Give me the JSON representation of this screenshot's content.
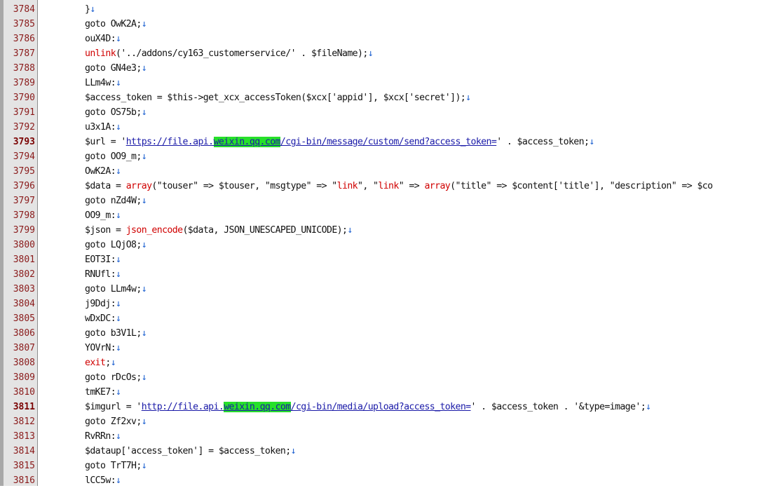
{
  "editor": {
    "colors": {
      "keyword": "#d00000",
      "url": "#1a1aa8",
      "highlight": "#27e02a",
      "newline_marker": "#1b5fd0",
      "line_number": "#8a1a1a"
    },
    "lines": [
      {
        "num": "3784",
        "segments": [
          {
            "t": "}"
          },
          {
            "t": "↓",
            "c": "arrow"
          }
        ]
      },
      {
        "num": "3785",
        "segments": [
          {
            "t": "goto OwK2A;"
          },
          {
            "t": "↓",
            "c": "arrow"
          }
        ]
      },
      {
        "num": "3786",
        "segments": [
          {
            "t": "ouX4D:"
          },
          {
            "t": "↓",
            "c": "arrow"
          }
        ]
      },
      {
        "num": "3787",
        "segments": [
          {
            "t": "unlink",
            "c": "keyword"
          },
          {
            "t": "('../addons/cy163_customerservice/' . $fileName);"
          },
          {
            "t": "↓",
            "c": "arrow"
          }
        ]
      },
      {
        "num": "3788",
        "segments": [
          {
            "t": "goto GN4e3;"
          },
          {
            "t": "↓",
            "c": "arrow"
          }
        ]
      },
      {
        "num": "3789",
        "segments": [
          {
            "t": "LLm4w:"
          },
          {
            "t": "↓",
            "c": "arrow"
          }
        ]
      },
      {
        "num": "3790",
        "segments": [
          {
            "t": "$access_token = $this->get_xcx_accessToken($xcx['appid'], $xcx['secret']);"
          },
          {
            "t": "↓",
            "c": "arrow"
          }
        ]
      },
      {
        "num": "3791",
        "segments": [
          {
            "t": "goto OS75b;"
          },
          {
            "t": "↓",
            "c": "arrow"
          }
        ]
      },
      {
        "num": "3792",
        "segments": [
          {
            "t": "u3x1A:"
          },
          {
            "t": "↓",
            "c": "arrow"
          }
        ]
      },
      {
        "num": "3793",
        "bold": true,
        "segments": [
          {
            "t": "$url = '"
          },
          {
            "t": "https://file.api.",
            "c": "url"
          },
          {
            "t": "weixin.qq.com",
            "c": "highlight"
          },
          {
            "t": "/cgi-bin/message/custom/send?access_token=",
            "c": "url"
          },
          {
            "t": "' . $access_token;"
          },
          {
            "t": "↓",
            "c": "arrow"
          }
        ]
      },
      {
        "num": "3794",
        "segments": [
          {
            "t": "goto OO9_m;"
          },
          {
            "t": "↓",
            "c": "arrow"
          }
        ]
      },
      {
        "num": "3795",
        "segments": [
          {
            "t": "OwK2A:"
          },
          {
            "t": "↓",
            "c": "arrow"
          }
        ]
      },
      {
        "num": "3796",
        "segments": [
          {
            "t": "$data = "
          },
          {
            "t": "array",
            "c": "keyword"
          },
          {
            "t": "(\"touser\" => $touser, \"msgtype\" => \""
          },
          {
            "t": "link",
            "c": "keyword"
          },
          {
            "t": "\", \""
          },
          {
            "t": "link",
            "c": "keyword"
          },
          {
            "t": "\" => "
          },
          {
            "t": "array",
            "c": "keyword"
          },
          {
            "t": "(\"title\" => $content['title'], \"description\" => $co"
          }
        ]
      },
      {
        "num": "3797",
        "segments": [
          {
            "t": "goto nZd4W;"
          },
          {
            "t": "↓",
            "c": "arrow"
          }
        ]
      },
      {
        "num": "3798",
        "segments": [
          {
            "t": "OO9_m:"
          },
          {
            "t": "↓",
            "c": "arrow"
          }
        ]
      },
      {
        "num": "3799",
        "segments": [
          {
            "t": "$json = "
          },
          {
            "t": "json_encode",
            "c": "keyword"
          },
          {
            "t": "($data, JSON_UNESCAPED_UNICODE);"
          },
          {
            "t": "↓",
            "c": "arrow"
          }
        ]
      },
      {
        "num": "3800",
        "segments": [
          {
            "t": "goto LQjO8;"
          },
          {
            "t": "↓",
            "c": "arrow"
          }
        ]
      },
      {
        "num": "3801",
        "segments": [
          {
            "t": "EOT3I:"
          },
          {
            "t": "↓",
            "c": "arrow"
          }
        ]
      },
      {
        "num": "3802",
        "segments": [
          {
            "t": "RNUfl:"
          },
          {
            "t": "↓",
            "c": "arrow"
          }
        ]
      },
      {
        "num": "3803",
        "segments": [
          {
            "t": "goto LLm4w;"
          },
          {
            "t": "↓",
            "c": "arrow"
          }
        ]
      },
      {
        "num": "3804",
        "segments": [
          {
            "t": "j9Ddj:"
          },
          {
            "t": "↓",
            "c": "arrow"
          }
        ]
      },
      {
        "num": "3805",
        "segments": [
          {
            "t": "wDxDC:"
          },
          {
            "t": "↓",
            "c": "arrow"
          }
        ]
      },
      {
        "num": "3806",
        "segments": [
          {
            "t": "goto b3V1L;"
          },
          {
            "t": "↓",
            "c": "arrow"
          }
        ]
      },
      {
        "num": "3807",
        "segments": [
          {
            "t": "YOVrN:"
          },
          {
            "t": "↓",
            "c": "arrow"
          }
        ]
      },
      {
        "num": "3808",
        "segments": [
          {
            "t": "exit",
            "c": "keyword"
          },
          {
            "t": ";"
          },
          {
            "t": "↓",
            "c": "arrow"
          }
        ]
      },
      {
        "num": "3809",
        "segments": [
          {
            "t": "goto rDcOs;"
          },
          {
            "t": "↓",
            "c": "arrow"
          }
        ]
      },
      {
        "num": "3810",
        "segments": [
          {
            "t": "tmKE7:"
          },
          {
            "t": "↓",
            "c": "arrow"
          }
        ]
      },
      {
        "num": "3811",
        "bold": true,
        "segments": [
          {
            "t": "$imgurl = '"
          },
          {
            "t": "http://file.api.",
            "c": "url"
          },
          {
            "t": "weixin.qq.com",
            "c": "highlight"
          },
          {
            "t": "/cgi-bin/media/upload?access_token=",
            "c": "url"
          },
          {
            "t": "' . $access_token . '&type=image';"
          },
          {
            "t": "↓",
            "c": "arrow"
          }
        ]
      },
      {
        "num": "3812",
        "segments": [
          {
            "t": "goto Zf2xv;"
          },
          {
            "t": "↓",
            "c": "arrow"
          }
        ]
      },
      {
        "num": "3813",
        "segments": [
          {
            "t": "RvRRn:"
          },
          {
            "t": "↓",
            "c": "arrow"
          }
        ]
      },
      {
        "num": "3814",
        "segments": [
          {
            "t": "$dataup['access_token'] = $access_token;"
          },
          {
            "t": "↓",
            "c": "arrow"
          }
        ]
      },
      {
        "num": "3815",
        "segments": [
          {
            "t": "goto TrT7H;"
          },
          {
            "t": "↓",
            "c": "arrow"
          }
        ]
      },
      {
        "num": "3816",
        "segments": [
          {
            "t": "lCC5w:"
          },
          {
            "t": "↓",
            "c": "arrow"
          }
        ]
      }
    ]
  }
}
